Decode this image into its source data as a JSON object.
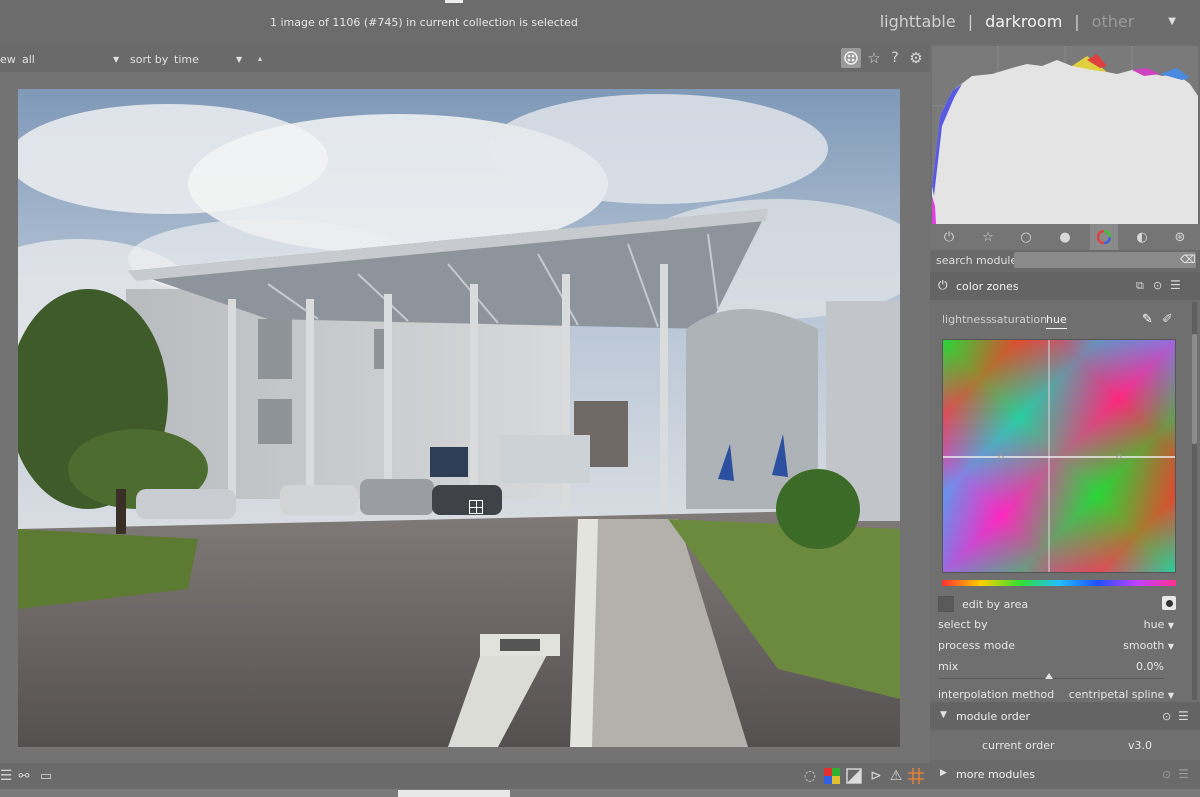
{
  "header": {
    "status_text": "1 image of 1106 (#745) in current collection is selected",
    "views": {
      "lighttable": "lighttable",
      "sep1": "|",
      "darkroom": "darkroom",
      "sep2": "|",
      "other": "other"
    }
  },
  "filterbar": {
    "view_label_partial": "ew",
    "view_value": "all",
    "sort_label": "sort by",
    "sort_value": "time",
    "sort_order_glyph": "▴"
  },
  "right_panel": {
    "search_label": "search module",
    "search_placeholder": "",
    "module": {
      "title": "color zones",
      "tabs": [
        "lightness",
        "saturation",
        "hue"
      ],
      "active_tab": "hue",
      "edit_by_area_label": "edit by area",
      "select_by_label": "select by",
      "select_by_value": "hue",
      "process_mode_label": "process mode",
      "process_mode_value": "smooth",
      "mix_label": "mix",
      "mix_value": "0.0%",
      "interpolation_label": "interpolation method",
      "interpolation_value": "centripetal spline"
    },
    "module_order": {
      "title": "module order",
      "current_label": "current order",
      "current_value": "v3.0"
    },
    "more_modules": "more modules"
  },
  "colors": {
    "panel_bg": "#6f6f6f",
    "header_bg": "#646464",
    "text": "#e6e6e6",
    "accent_active": "#f2f2f2"
  },
  "icons": {
    "topbar": [
      "focus-peaking-icon",
      "star-icon",
      "help-icon",
      "gear-icon"
    ],
    "groups": [
      "power-icon",
      "star-icon",
      "circle-icon",
      "sphere-icon",
      "color-wheel-icon",
      "contrast-icon",
      "lens-icon"
    ],
    "bottom_left": [
      "list-icon",
      "styles-icon",
      "display-icon"
    ],
    "bottom_right": [
      "bulb-icon",
      "color-assess-icon",
      "softproof-icon",
      "gamut-icon",
      "warning-icon",
      "guides-icon"
    ]
  }
}
